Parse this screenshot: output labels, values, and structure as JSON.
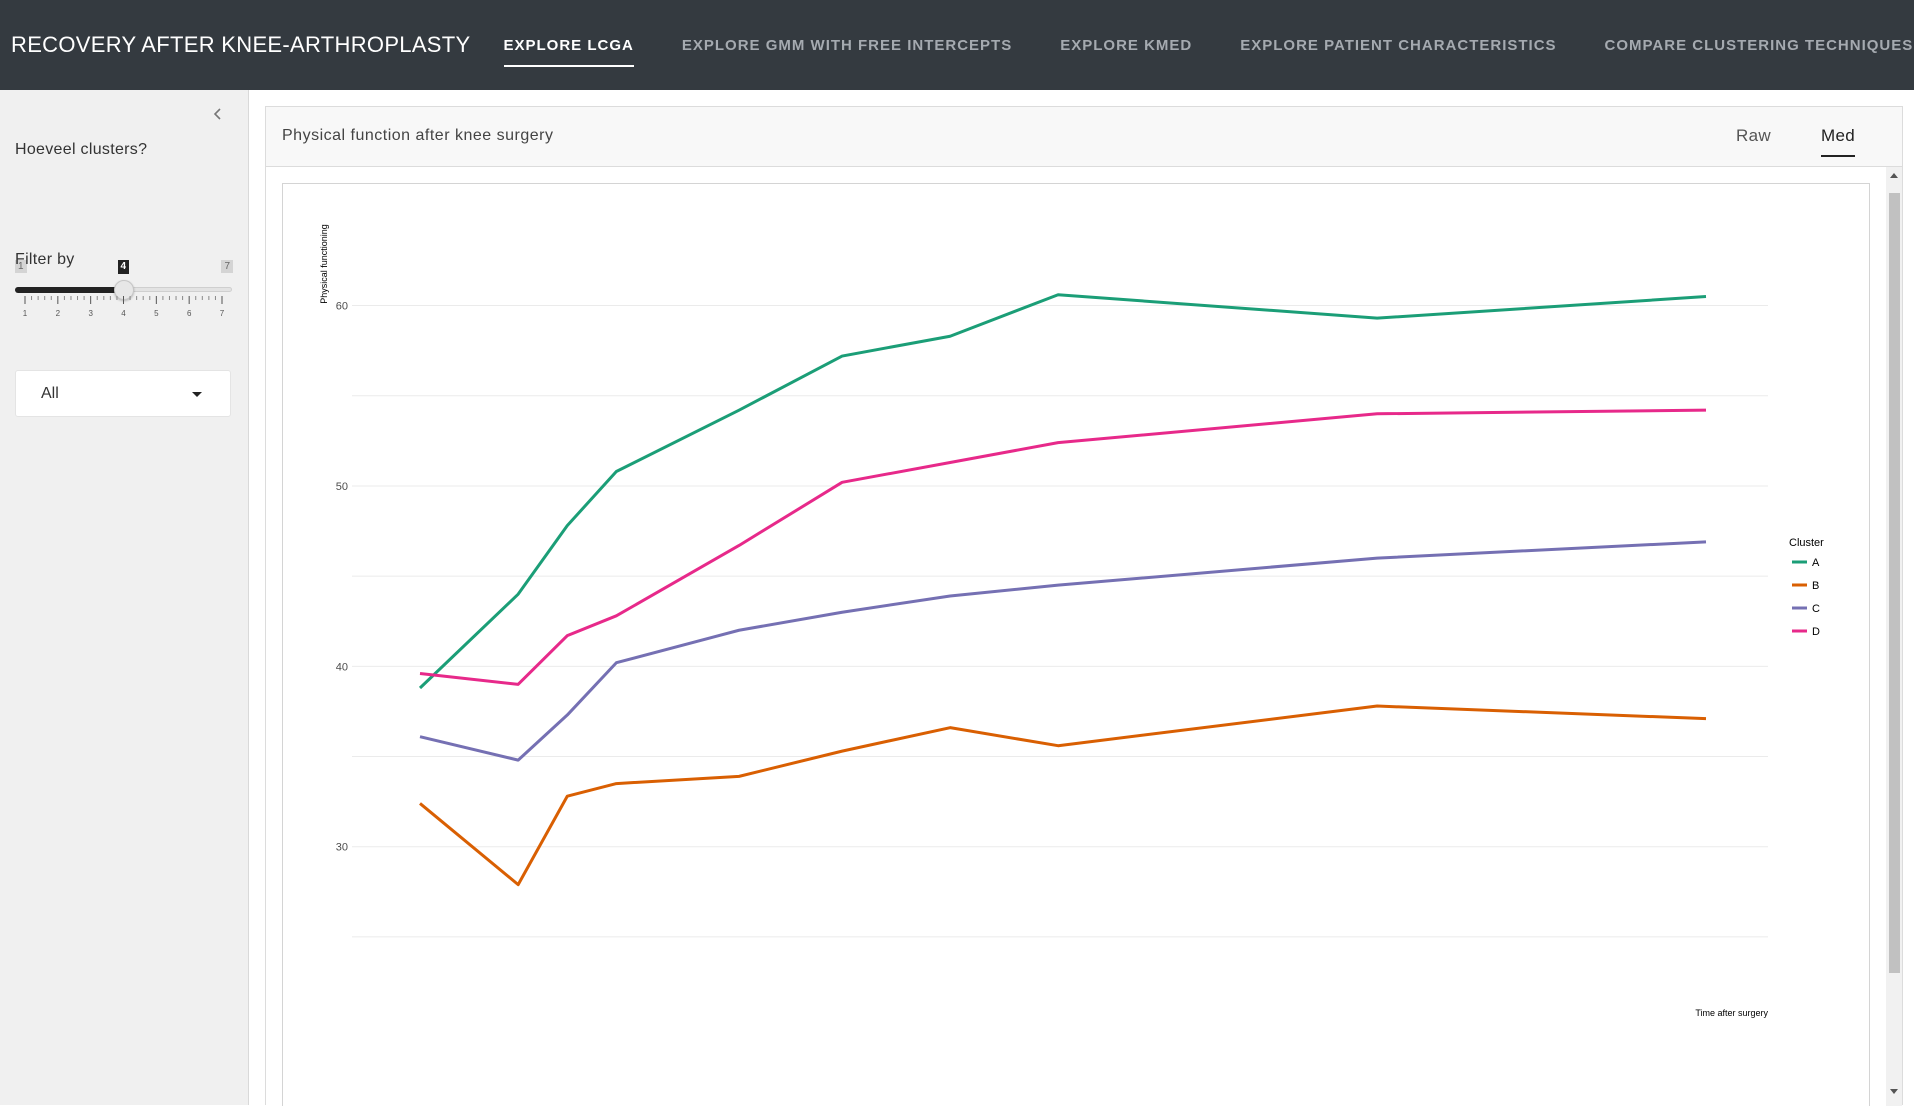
{
  "navbar": {
    "brand": "RECOVERY AFTER KNEE-ARTHROPLASTY",
    "tabs": [
      {
        "label": "EXPLORE LCGA",
        "active": true
      },
      {
        "label": "EXPLORE GMM WITH FREE INTERCEPTS",
        "active": false
      },
      {
        "label": "EXPLORE KMED",
        "active": false
      },
      {
        "label": "EXPLORE PATIENT CHARACTERISTICS",
        "active": false
      },
      {
        "label": "COMPARE CLUSTERING TECHNIQUES",
        "active": false
      }
    ]
  },
  "sidebar": {
    "clusters_label": "Hoeveel clusters?",
    "slider": {
      "min": 1,
      "max": 7,
      "value": 4,
      "tick_labels": [
        "1",
        "2",
        "3",
        "4",
        "5",
        "6",
        "7"
      ]
    },
    "filter_label": "Filter by",
    "filter_value": "All",
    "collapse_icon": "chevron-left-icon"
  },
  "card": {
    "title": "Physical function after knee surgery",
    "pills": [
      {
        "label": "Raw",
        "active": false
      },
      {
        "label": "Med",
        "active": true
      }
    ]
  },
  "chart_data": {
    "type": "line",
    "title": "",
    "xlabel": "Time after surgery",
    "ylabel": "Physical functioning",
    "ylim": [
      23,
      63.8
    ],
    "y_ticks": [
      30,
      40,
      50,
      60
    ],
    "grid": true,
    "legend_title": "Cluster",
    "legend_position": "right",
    "x": [
      0,
      1,
      1.5,
      2,
      3.25,
      4.3,
      5.4,
      6.5,
      9.75,
      13.1
    ],
    "series": [
      {
        "name": "A",
        "color": "#1b9e77",
        "values": [
          38.8,
          44.0,
          47.8,
          50.8,
          54.2,
          57.2,
          58.3,
          60.6,
          59.3,
          60.5
        ]
      },
      {
        "name": "B",
        "color": "#d95f02",
        "values": [
          32.4,
          27.9,
          32.8,
          33.5,
          33.9,
          35.3,
          36.6,
          35.6,
          37.8,
          37.1
        ]
      },
      {
        "name": "C",
        "color": "#7570b3",
        "values": [
          36.1,
          34.8,
          37.3,
          40.2,
          42.0,
          43.0,
          43.9,
          44.5,
          46.0,
          46.9
        ]
      },
      {
        "name": "D",
        "color": "#e7298a",
        "values": [
          39.6,
          39.0,
          41.7,
          42.8,
          46.7,
          50.2,
          51.3,
          52.4,
          54.0,
          54.2
        ]
      }
    ]
  }
}
